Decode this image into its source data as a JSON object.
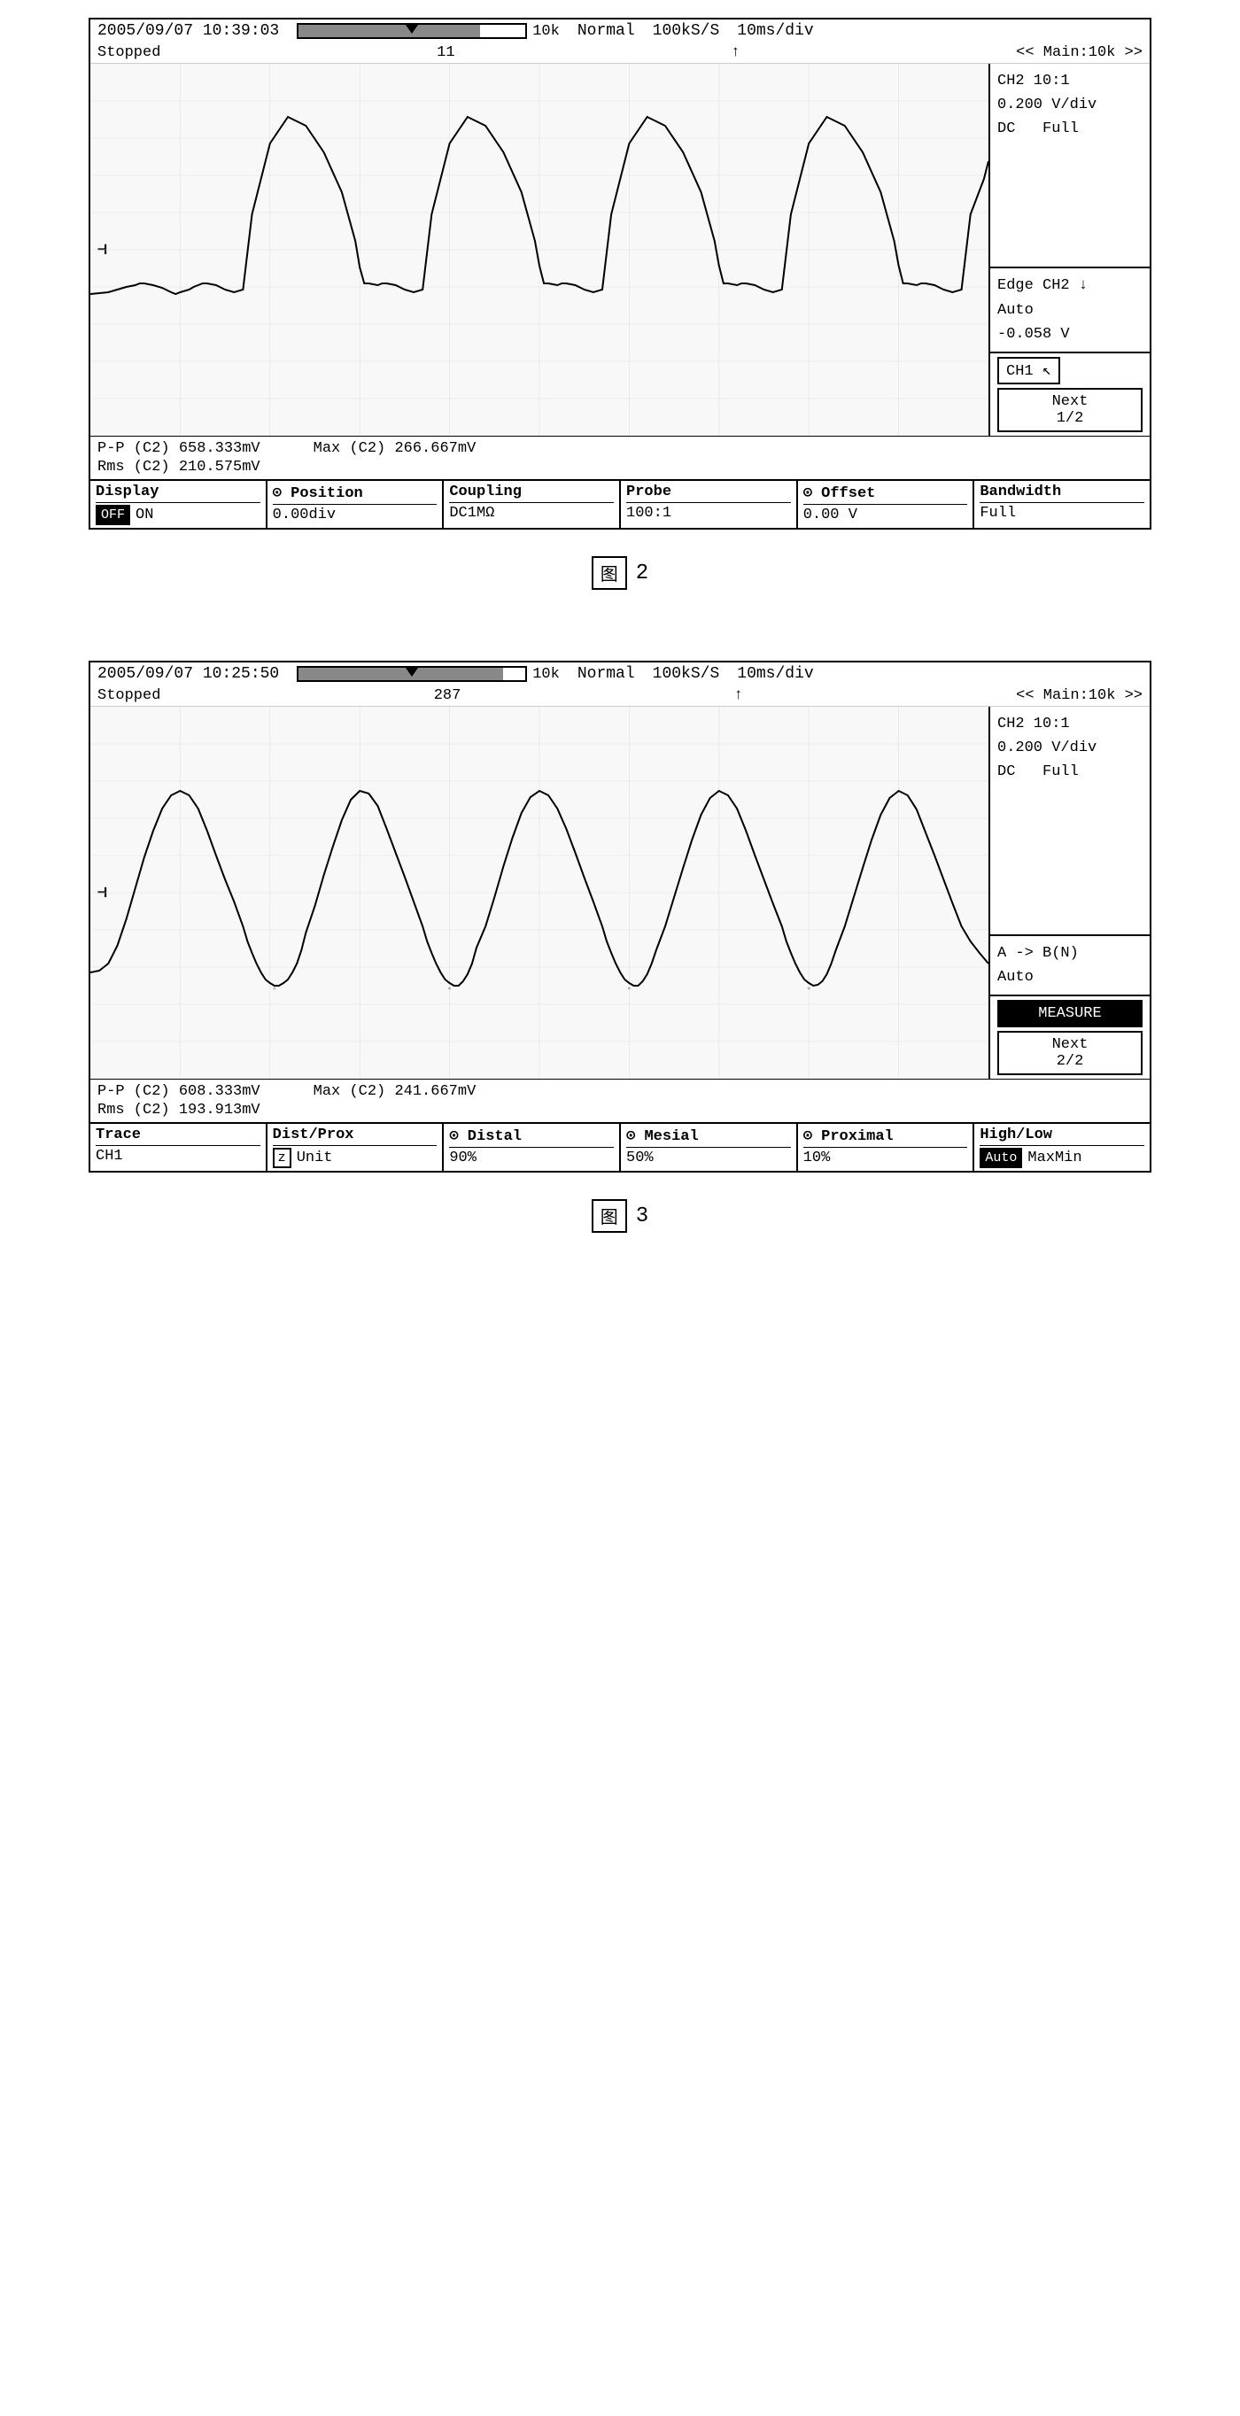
{
  "figure2": {
    "timestamp": "2005/09/07 10:39:03",
    "status": "Stopped",
    "trigger_pos": "11",
    "memory_label": "10k",
    "mode": "Normal",
    "sample_rate": "100kS/S",
    "time_div": "10ms/div",
    "main_label": "<< Main:10k >>",
    "ch2_info": {
      "probe": "CH2 10:1",
      "vdiv": "0.200 V/div",
      "coupling": "DC",
      "bandwidth": "Full"
    },
    "trigger_info": {
      "edge": "Edge CH2 ↓",
      "mode": "Auto",
      "level": "-0.058 V"
    },
    "ch1_label": "CH1 ↖",
    "next_label": "Next",
    "next_page": "1/2",
    "measurements": {
      "pp": "P-P (C2)   658.333mV",
      "max": "Max (C2)   266.667mV",
      "rms": "Rms (C2)   210.575mV"
    },
    "controls": {
      "display": {
        "label": "Display",
        "off": "OFF",
        "on": "ON"
      },
      "position": {
        "label": "Position",
        "value": "0.00div",
        "icon": "⊙"
      },
      "coupling": {
        "label": "Coupling",
        "value": "DC1MΩ"
      },
      "probe": {
        "label": "Probe",
        "value": "100:1"
      },
      "offset": {
        "label": "Offset",
        "value": "0.00 V",
        "icon": "⊙"
      },
      "bandwidth": {
        "label": "Bandwidth",
        "value": "Full"
      }
    }
  },
  "figure3": {
    "timestamp": "2005/09/07 10:25:50",
    "status": "Stopped",
    "trigger_pos": "287",
    "memory_label": "10k",
    "mode": "Normal",
    "sample_rate": "100kS/S",
    "time_div": "10ms/div",
    "main_label": "<< Main:10k >>",
    "ch2_info": {
      "probe": "CH2 10:1",
      "vdiv": "0.200 V/div",
      "coupling": "DC",
      "bandwidth": "Full"
    },
    "trigger_info": {
      "edge": "A -> B(N)",
      "mode": "Auto"
    },
    "measure_label": "MEASURE",
    "next_label": "Next",
    "next_page": "2/2",
    "measurements": {
      "pp": "P-P (C2)   608.333mV",
      "max": "Max (C2)   241.667mV",
      "rms": "Rms (C2)   193.913mV"
    },
    "controls": {
      "trace": {
        "label": "Trace",
        "value": "CH1"
      },
      "dist_prox": {
        "label": "Dist/Prox",
        "icon": "z",
        "unit": "Unit"
      },
      "distal": {
        "label": "Distal",
        "icon": "⊙",
        "value": "90%"
      },
      "mesial": {
        "label": "Mesial",
        "icon": "⊙",
        "value": "50%"
      },
      "proximal": {
        "label": "Proximal",
        "value": "10%"
      },
      "high_low": {
        "label": "High/Low",
        "auto": "Auto",
        "maxmin": "MaxMin"
      }
    }
  },
  "fig2_caption": "图 2",
  "fig3_caption": "图 3"
}
